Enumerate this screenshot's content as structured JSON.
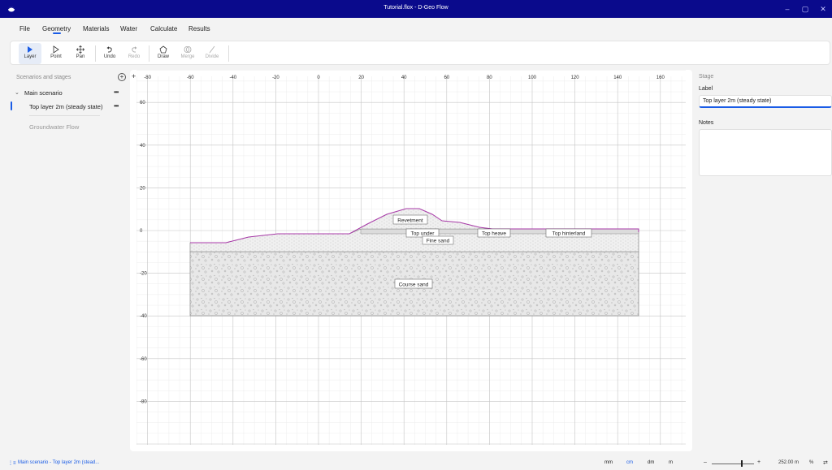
{
  "window": {
    "title": "Tutorial.flox - D-Geo Flow",
    "minimize": "–",
    "maximize": "▢",
    "close": "✕"
  },
  "menu": [
    "File",
    "Geometry",
    "Materials",
    "Water",
    "Calculate",
    "Results"
  ],
  "toolbar": {
    "layer": "Layer",
    "point": "Point",
    "pan": "Pan",
    "undo": "Undo",
    "redo": "Redo",
    "draw": "Draw",
    "merge": "Merge",
    "divide": "Divide"
  },
  "sidebar": {
    "header": "Scenarios and stages",
    "add": "+",
    "scenario": "Main scenario",
    "stage": "Top layer 2m (steady state)",
    "more": "•••",
    "calculation": "Groundwater Flow"
  },
  "canvas": {
    "x_ticks": [
      "-80",
      "-60",
      "-40",
      "-20",
      "0",
      "20",
      "40",
      "60",
      "80",
      "100",
      "120",
      "140",
      "160"
    ],
    "y_ticks": [
      "60",
      "40",
      "20",
      "0",
      "-20",
      "-40",
      "-60",
      "-80"
    ],
    "plus": "+",
    "layers": {
      "revetment": "Revetment",
      "top_under": "Top under",
      "top_heave": "Top heave",
      "top_hinterland": "Top hinterland",
      "fine_sand": "Fine sand",
      "course_sand": "Course sand"
    },
    "accent": "#a83aa8"
  },
  "stage_panel": {
    "section": "Stage",
    "label_caption": "Label",
    "label_value": "Top layer 2m (steady state)",
    "notes_caption": "Notes"
  },
  "status": {
    "breadcrumb": "Main scenario - Top layer 2m (stead...",
    "units": [
      "mm",
      "cm",
      "dm",
      "m"
    ],
    "selected_unit": "cm",
    "zoom_minus": "–",
    "zoom_plus": "+",
    "scale": "252.00 m",
    "percent": "%"
  }
}
